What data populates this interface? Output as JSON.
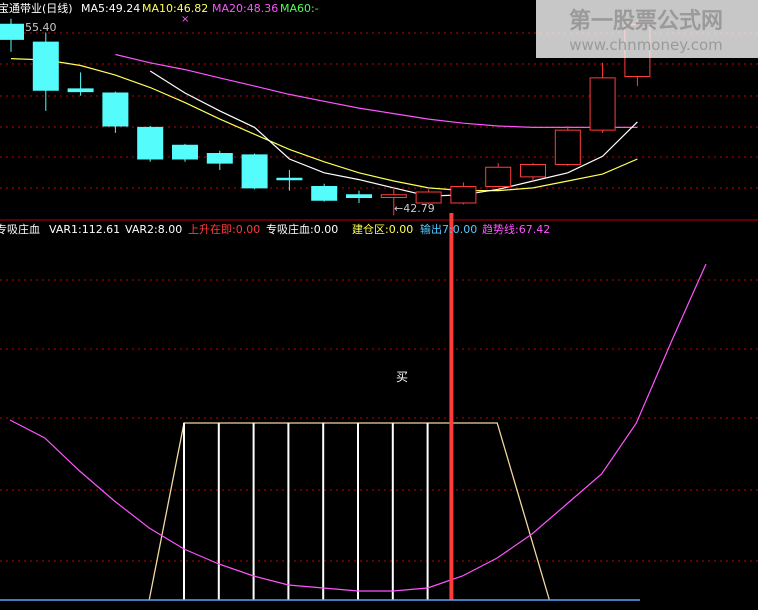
{
  "colors": {
    "background": "#000000",
    "up_candle": "#ff3c3c",
    "down_candle": "#54fcfc",
    "ma5": "#ffffff",
    "ma10": "#ffff54",
    "ma20": "#ff54ff",
    "grid": "#c00000",
    "separator": "#c00000",
    "axis_line": "#54a8fc",
    "white_label": "#ffffff",
    "red_label": "#ff3c3c",
    "yellow_label": "#ffff54",
    "cyan_label": "#54c8fc",
    "magenta_label": "#ff54ff",
    "watermark": "#e8e8e8"
  },
  "watermark": {
    "title": "第一股票公式网",
    "url": "www.chnmoney.com"
  },
  "header": {
    "title": "宝通带业(日线)",
    "ma5": "MA5:49.24",
    "ma10": "MA10:46.82",
    "ma20": "MA20:48.36",
    "ma60": "MA60:-"
  },
  "indicator_header": {
    "name": "专吸庄血",
    "var1": "VAR1:112.61",
    "var2": "VAR2:8.00",
    "rise": "上升在即:0.00",
    "zhuanxi": "专吸庄血:0.00",
    "jiancang": "建仓区:0.00",
    "shuchu": "输出7:0.00",
    "trend": "趋势线:67.42"
  },
  "annotations": {
    "high_marker": "55.40",
    "low_marker": "←42.79",
    "buy_label": "买",
    "cross_marker": "×"
  },
  "chart_data": [
    {
      "type": "candlestick",
      "title": "宝通带业(日线)",
      "series_labels": [
        "MA5:49.24",
        "MA10:46.82",
        "MA20:48.36",
        "MA60:-"
      ],
      "ylim": [
        41.6,
        56.0
      ],
      "candles": [
        {
          "o": 55.4,
          "c": 54.3,
          "h": 55.8,
          "l": 53.4
        },
        {
          "o": 54.1,
          "c": 50.6,
          "h": 54.8,
          "l": 49.1
        },
        {
          "o": 50.7,
          "c": 50.5,
          "h": 51.9,
          "l": 50.2
        },
        {
          "o": 50.4,
          "c": 48.0,
          "h": 50.5,
          "l": 47.5
        },
        {
          "o": 47.9,
          "c": 45.6,
          "h": 48.0,
          "l": 45.4
        },
        {
          "o": 46.6,
          "c": 45.6,
          "h": 46.7,
          "l": 45.4
        },
        {
          "o": 46.0,
          "c": 45.3,
          "h": 46.2,
          "l": 44.8
        },
        {
          "o": 45.9,
          "c": 43.5,
          "h": 46.0,
          "l": 43.4
        },
        {
          "o": 44.2,
          "c": 44.1,
          "h": 44.8,
          "l": 43.3
        },
        {
          "o": 43.6,
          "c": 42.6,
          "h": 43.8,
          "l": 42.5
        },
        {
          "o": 43.0,
          "c": 42.8,
          "h": 43.3,
          "l": 42.4
        },
        {
          "o": 42.8,
          "c": 43.0,
          "h": 43.6,
          "l": 41.5
        },
        {
          "o": 42.4,
          "c": 43.2,
          "h": 43.4,
          "l": 42.3
        },
        {
          "o": 42.4,
          "c": 43.6,
          "h": 43.9,
          "l": 42.3
        },
        {
          "o": 43.6,
          "c": 45.0,
          "h": 45.3,
          "l": 43.6
        },
        {
          "o": 44.3,
          "c": 45.2,
          "h": 45.3,
          "l": 44.0
        },
        {
          "o": 45.2,
          "c": 47.7,
          "h": 48.0,
          "l": 45.1
        },
        {
          "o": 47.7,
          "c": 51.5,
          "h": 52.6,
          "l": 47.5
        },
        {
          "o": 51.6,
          "c": 55.4,
          "h": 55.7,
          "l": 50.9
        }
      ],
      "ma5": [
        null,
        null,
        null,
        null,
        52.0,
        50.4,
        49.1,
        47.9,
        45.6,
        44.6,
        44.1,
        43.5,
        42.9,
        43.0,
        43.4,
        44.0,
        44.6,
        45.8,
        48.3
      ],
      "ma10": [
        52.9,
        52.8,
        52.4,
        51.7,
        50.8,
        49.7,
        48.5,
        47.4,
        46.3,
        45.4,
        44.6,
        44.0,
        43.5,
        43.3,
        43.3,
        43.5,
        44.0,
        44.5,
        45.6
      ],
      "ma20": [
        null,
        null,
        null,
        53.2,
        52.6,
        52.1,
        51.5,
        50.9,
        50.3,
        49.8,
        49.3,
        48.9,
        48.5,
        48.2,
        48.0,
        47.9,
        47.9,
        47.9,
        47.9
      ]
    },
    {
      "type": "line",
      "title": "专吸庄血",
      "ylim": [
        0,
        120
      ],
      "trend_line": [
        60,
        54,
        43,
        33,
        24,
        17,
        12,
        8,
        5,
        4,
        3,
        3,
        4,
        8,
        14,
        22,
        32,
        42,
        59,
        86,
        112
      ],
      "zone_band": {
        "value": 59,
        "ramp_start": 4,
        "flat_start": 5,
        "flat_end": 14,
        "ramp_end": 15.5
      },
      "white_bars": [
        5,
        6,
        7,
        8,
        9,
        10,
        11,
        12
      ],
      "buy_signal_index": 13,
      "buy_signal_value": 129
    }
  ]
}
